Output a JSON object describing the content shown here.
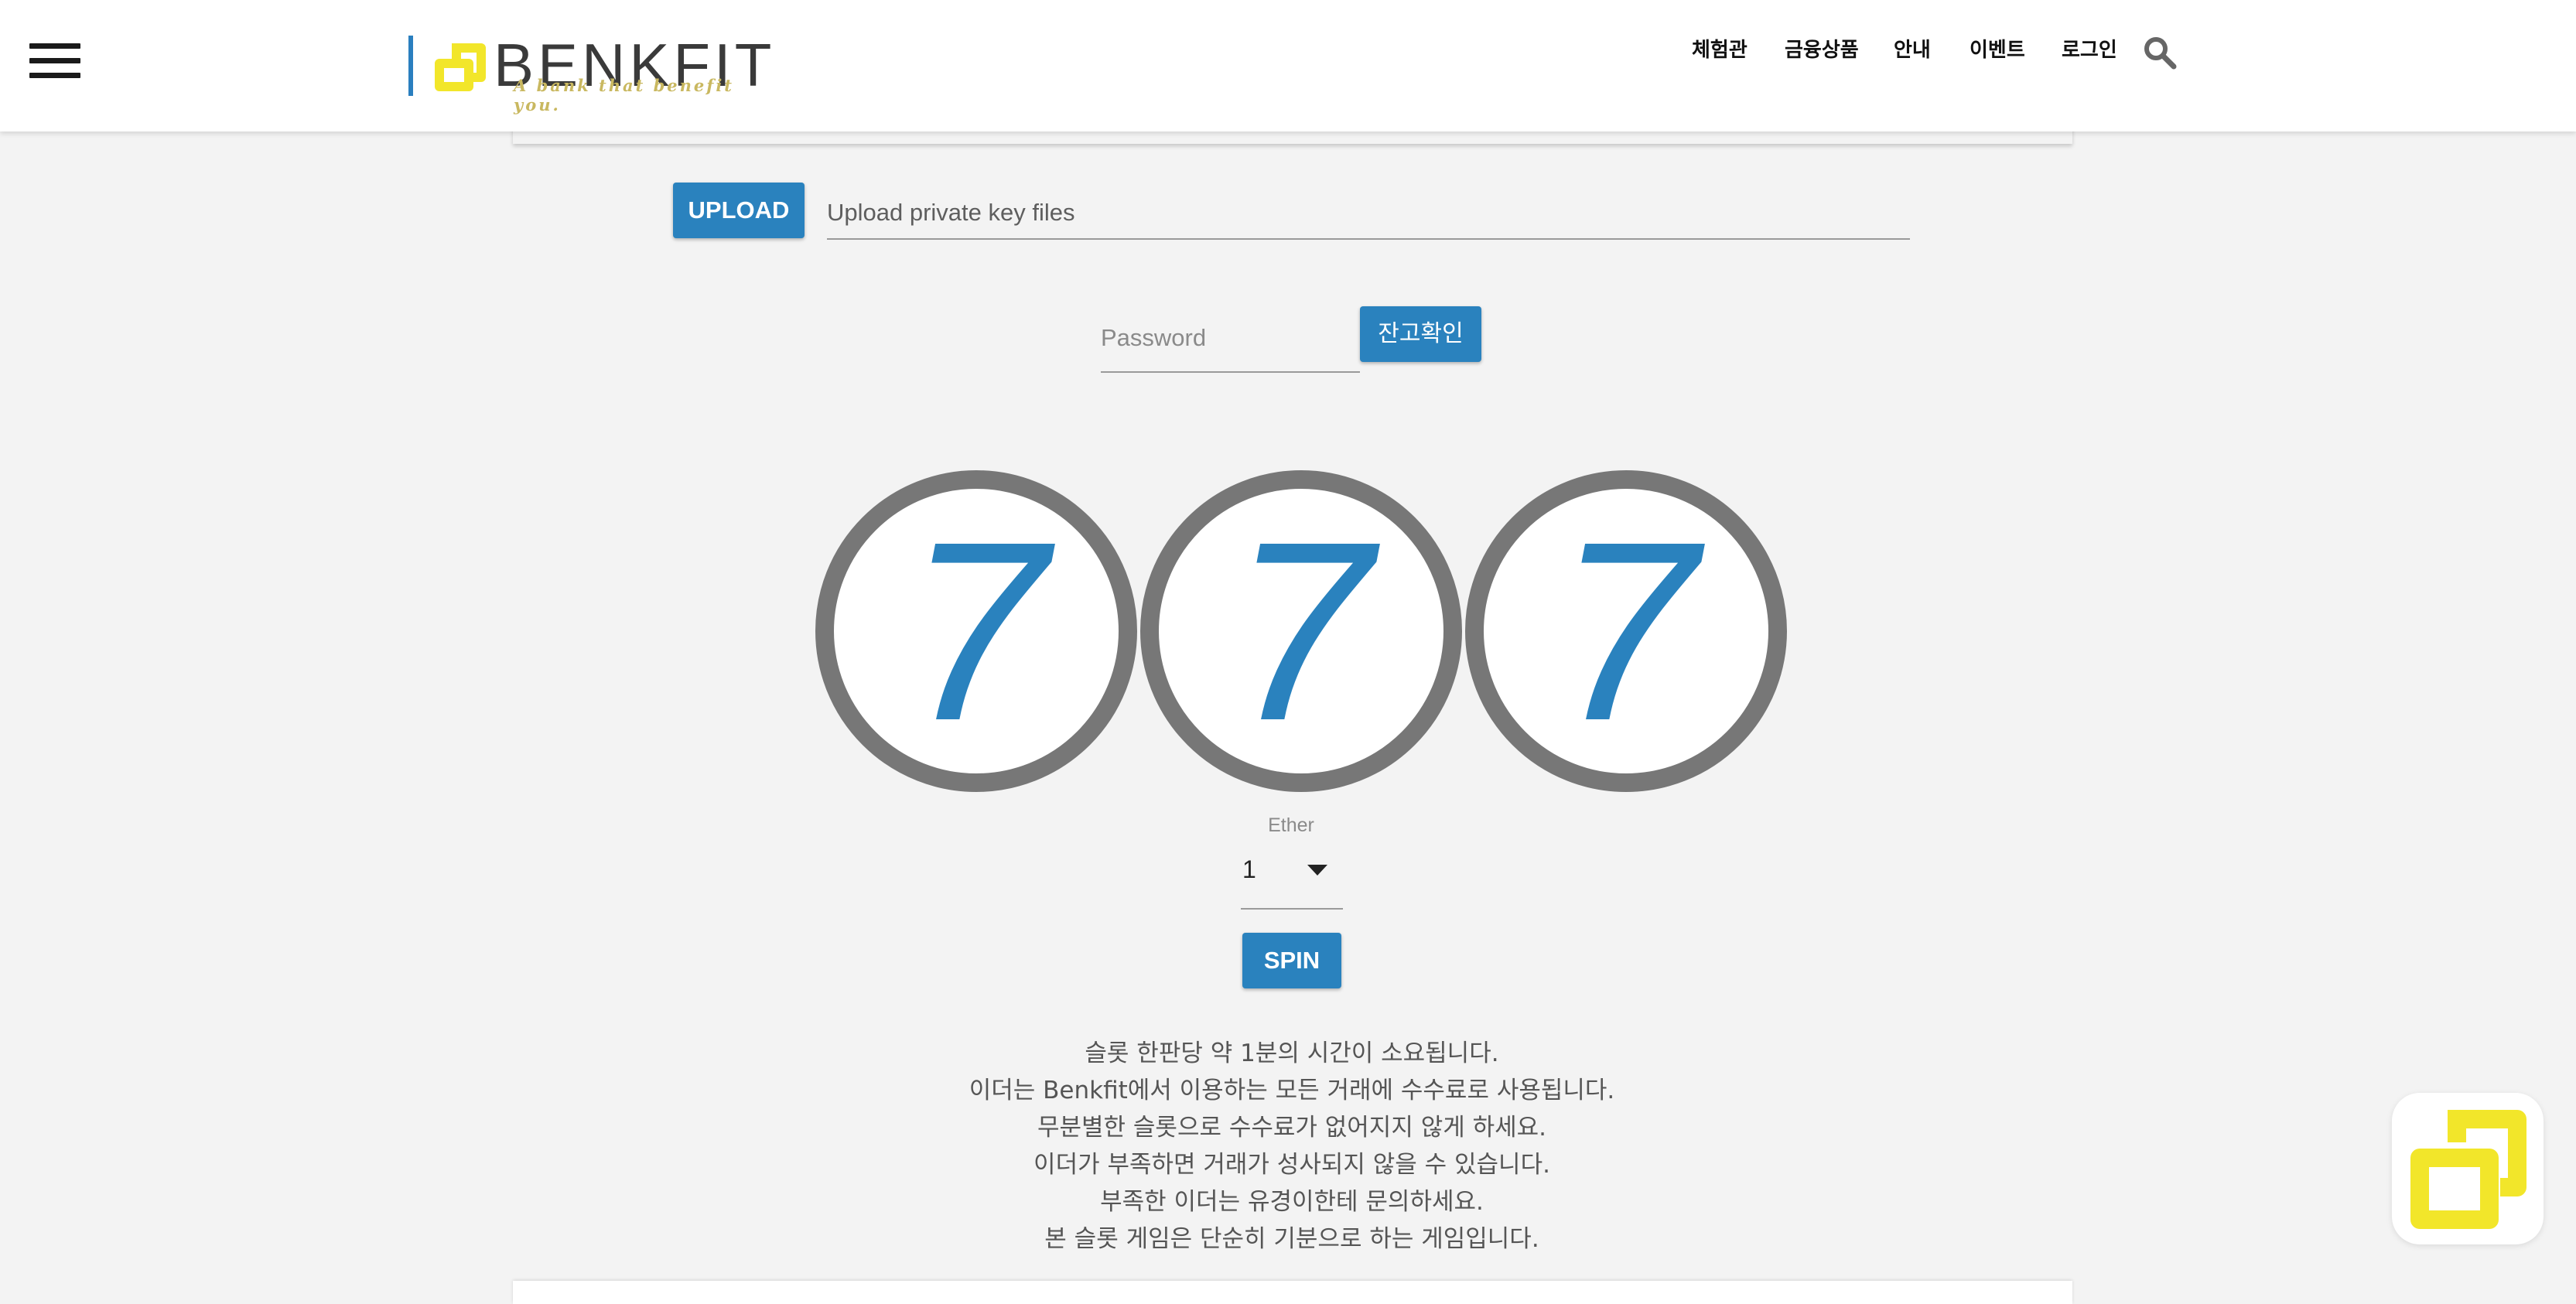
{
  "header": {
    "logo": {
      "wordmark": "BENKFIT",
      "tagline": "A bank that benefit you."
    },
    "nav": [
      {
        "label": "체험관"
      },
      {
        "label": "금융상품"
      },
      {
        "label": "안내"
      },
      {
        "label": "이벤트"
      },
      {
        "label": "로그인"
      }
    ],
    "icons": {
      "menu": "hamburger-icon",
      "search": "search-icon"
    }
  },
  "upload": {
    "button_label": "UPLOAD",
    "placeholder": "Upload private key files"
  },
  "password": {
    "placeholder": "Password",
    "button_label": "잔고확인"
  },
  "slot": {
    "reels": [
      "7",
      "7",
      "7"
    ]
  },
  "bet": {
    "label": "Ether",
    "selected": "1"
  },
  "spin": {
    "button_label": "SPIN"
  },
  "info_lines": [
    "슬롯 한판당 약 1분의 시간이 소요됩니다.",
    "이더는 Benkfit에서 이용하는 모든 거래에 수수료로 사용됩니다.",
    "무분별한 슬롯으로 수수료가 없어지지 않게 하세요.",
    "이더가 부족하면 거래가 성사되지 않을 수 있습니다.",
    "부족한 이더는 유경이한테 문의하세요.",
    "본 슬롯 게임은 단순히 기분으로 하는 게임입니다."
  ],
  "colors": {
    "accent": "#2a82be",
    "brand_yellow": "#f2e62a",
    "reel_border": "#777777",
    "background": "#f3f3f3"
  }
}
